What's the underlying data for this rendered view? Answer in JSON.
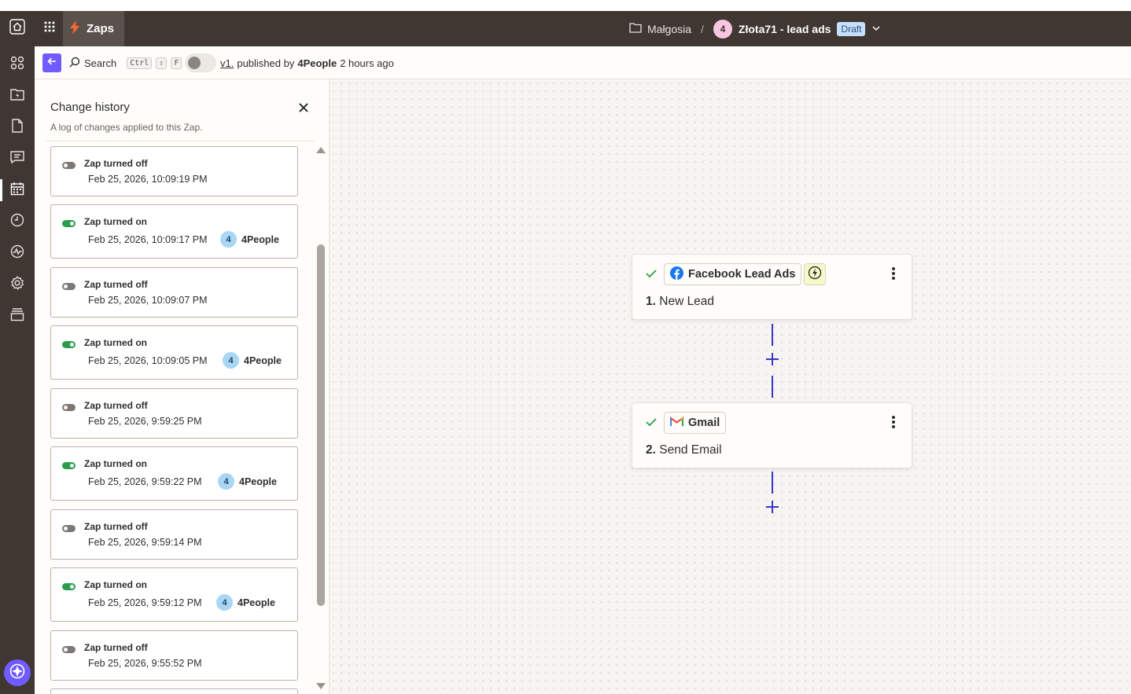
{
  "topbar": {
    "app_tab": "Zaps",
    "folder": "Małgosia",
    "separator": "/",
    "owner_badge": "4",
    "zap_name": "Złota71 - lead ads",
    "status": "Draft"
  },
  "subbar": {
    "search_label": "Search",
    "shortcut": [
      "Ctrl",
      "⇧",
      "F"
    ],
    "version": "v1.",
    "published_by": "published by",
    "publisher": "4People",
    "published_ago": "2 hours ago"
  },
  "history": {
    "title": "Change history",
    "subtitle": "A log of changes applied to this Zap.",
    "entries": [
      {
        "title": "Zap turned off",
        "date": "Feb 25, 2026, 10:09:19 PM",
        "on": false
      },
      {
        "title": "Zap turned on",
        "date": "Feb 25, 2026, 10:09:17 PM",
        "on": true,
        "avatar": "4",
        "user": "4People"
      },
      {
        "title": "Zap turned off",
        "date": "Feb 25, 2026, 10:09:07 PM",
        "on": false
      },
      {
        "title": "Zap turned on",
        "date": "Feb 25, 2026, 10:09:05 PM",
        "on": true,
        "avatar": "4",
        "user": "4People"
      },
      {
        "title": "Zap turned off",
        "date": "Feb 25, 2026, 9:59:25 PM",
        "on": false
      },
      {
        "title": "Zap turned on",
        "date": "Feb 25, 2026, 9:59:22 PM",
        "on": true,
        "avatar": "4",
        "user": "4People"
      },
      {
        "title": "Zap turned off",
        "date": "Feb 25, 2026, 9:59:14 PM",
        "on": false
      },
      {
        "title": "Zap turned on",
        "date": "Feb 25, 2026, 9:59:12 PM",
        "on": true,
        "avatar": "4",
        "user": "4People"
      },
      {
        "title": "Zap turned off",
        "date": "Feb 25, 2026, 9:55:52 PM",
        "on": false
      }
    ]
  },
  "steps": [
    {
      "app": "Facebook Lead Ads",
      "number": "1.",
      "name": "New Lead"
    },
    {
      "app": "Gmail",
      "number": "2.",
      "name": "Send Email"
    }
  ],
  "colors": {
    "accent": "#6f5bff",
    "topbar": "#403733",
    "connector": "#3b37c8",
    "on": "#2a9d4d"
  }
}
